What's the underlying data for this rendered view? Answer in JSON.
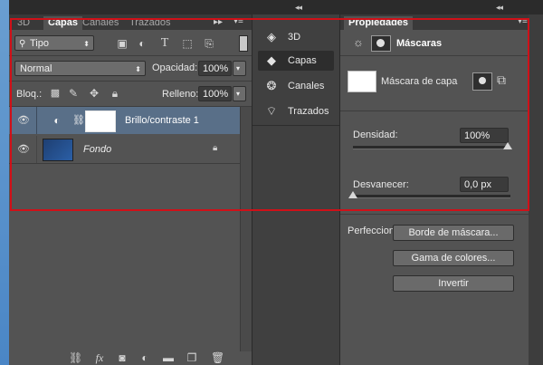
{
  "top_bar": {
    "collapse_left": "◂◂",
    "collapse_right": "◂◂"
  },
  "layers_panel": {
    "tabs": [
      "3D",
      "Capas",
      "Canales",
      "Trazados"
    ],
    "active_tab": "Capas",
    "expand": "▸▸",
    "menu": "▾≡",
    "filter_select": "Tipo",
    "blend_mode": "Normal",
    "opacity_label": "Opacidad:",
    "opacity_value": "100%",
    "lock_label": "Bloq.:",
    "fill_label": "Relleno:",
    "fill_value": "100%",
    "layers": [
      {
        "name": "Brillo/contraste 1",
        "selected": true
      },
      {
        "name": "Fondo",
        "selected": false
      }
    ],
    "bottom_tools": [
      "link-icon",
      "fx-icon",
      "mask-icon",
      "adjustment-icon",
      "folder-icon",
      "new-layer-icon",
      "trash-icon"
    ],
    "fx_text": "fx"
  },
  "dock": {
    "items": [
      {
        "icon": "3d-icon",
        "label": "3D"
      },
      {
        "icon": "layers-icon",
        "label": "Capas"
      },
      {
        "icon": "channels-icon",
        "label": "Canales"
      },
      {
        "icon": "paths-icon",
        "label": "Trazados"
      }
    ],
    "active": "Capas"
  },
  "properties_panel": {
    "tab": "Propiedades",
    "title": "Máscaras",
    "mask_type": "Máscara de capa",
    "density_label": "Densidad:",
    "density_value": "100%",
    "feather_label": "Desvanecer:",
    "feather_value": "0,0 px",
    "refine_label": "Perfeccionar:",
    "buttons": [
      "Borde de máscara...",
      "Gama de colores...",
      "Invertir"
    ]
  },
  "colors": {
    "highlight": "#d01018",
    "selected_row": "#596f88"
  }
}
